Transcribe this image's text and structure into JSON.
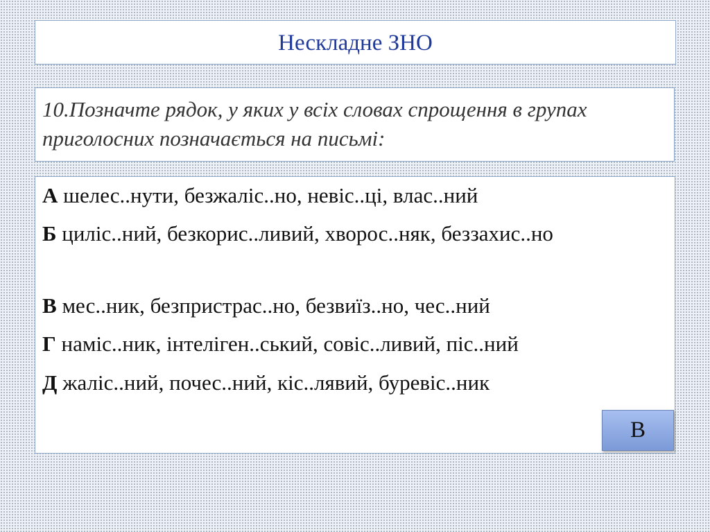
{
  "header": {
    "title": "Нескладне ЗНО"
  },
  "question": {
    "text": "10.Позначте рядок, у яких у всіх словах спрощення в групах приголосних позначається на письмі:"
  },
  "options": [
    {
      "letter": "А",
      "text": "шелес..нути, безжаліс..но, невіс..ці, влас..ний"
    },
    {
      "letter": "Б",
      "text": "циліс..ний, безкорис..ливий, хворос..няк, беззахис..но"
    },
    {
      "letter": "В",
      "text": "мес..ник, безпристрас..но, безвиїз..но, чес..ний"
    },
    {
      "letter": "Г",
      "text": "наміс..ник, інтеліген..ський, совіс..ливий, піс..ний"
    },
    {
      "letter": "Д",
      "text": "жаліс..ний, почес..ний, кіс..лявий, буревіс..ник"
    }
  ],
  "answer_button": {
    "label": "В"
  },
  "colors": {
    "title": "#1f3a9a",
    "box_border": "#8fa7c8",
    "button": "#8ea9e3"
  }
}
